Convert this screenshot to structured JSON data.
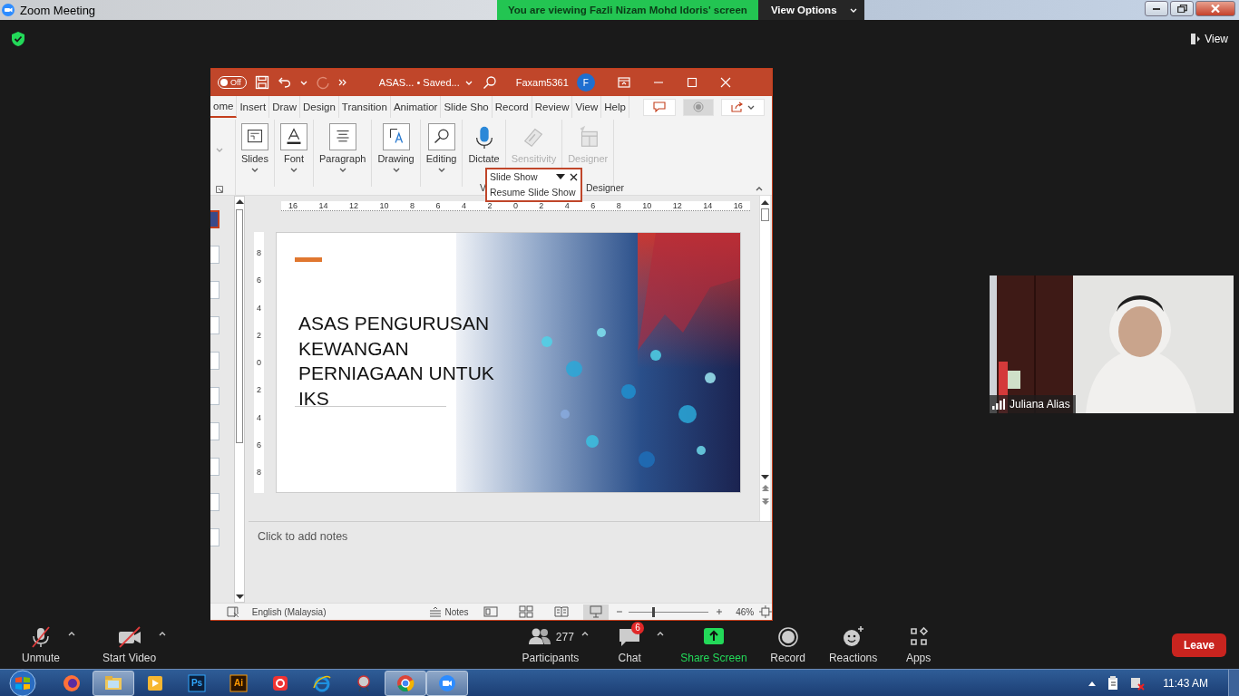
{
  "window": {
    "title": "Zoom Meeting"
  },
  "share_banner": {
    "text": "You are viewing Fazli Nizam Mohd Idoris' screen",
    "options": "View Options"
  },
  "view_button": "View",
  "shared_screen": {
    "title_bar": {
      "autosave": "Off",
      "autosave_on": false,
      "document": "ASAS...  • Saved...",
      "user": "Faxam5361",
      "avatar": "F"
    },
    "tabs": [
      {
        "label": "ome",
        "selected": true
      },
      {
        "label": "Insert",
        "selected": false
      },
      {
        "label": "Draw",
        "selected": false
      },
      {
        "label": "Design",
        "selected": false
      },
      {
        "label": "Transition",
        "selected": false
      },
      {
        "label": "Animatior",
        "selected": false
      },
      {
        "label": "Slide Sho",
        "selected": false
      },
      {
        "label": "Record",
        "selected": false
      },
      {
        "label": "Review",
        "selected": false
      },
      {
        "label": "View",
        "selected": false
      },
      {
        "label": "Help",
        "selected": false
      }
    ],
    "ribbon_groups": [
      {
        "label": "Slides",
        "kind": "slides",
        "disabled": false,
        "menu": true
      },
      {
        "label": "Font",
        "kind": "font",
        "disabled": false,
        "menu": true
      },
      {
        "label": "Paragraph",
        "kind": "paragraph",
        "disabled": false,
        "menu": true
      },
      {
        "label": "Drawing",
        "kind": "drawing",
        "disabled": false,
        "menu": true
      },
      {
        "label": "Editing",
        "kind": "editing",
        "disabled": false,
        "menu": true
      },
      {
        "label": "Dictate",
        "kind": "dictate",
        "disabled": false,
        "menu": false
      },
      {
        "label": "Sensitivity",
        "kind": "sensitivity",
        "disabled": true,
        "menu": false
      },
      {
        "label": "Designer",
        "kind": "designer",
        "disabled": true,
        "menu": false
      }
    ],
    "group_labels": [
      "V",
      "Designer"
    ],
    "popup": {
      "title": "Slide Show",
      "action": "Resume Slide Show"
    },
    "thumbnails": [
      {
        "selected": true
      },
      {
        "selected": false
      },
      {
        "selected": false
      },
      {
        "selected": false
      },
      {
        "selected": false
      },
      {
        "selected": false
      },
      {
        "selected": false
      },
      {
        "selected": false
      },
      {
        "selected": false
      },
      {
        "selected": false
      }
    ],
    "horizontal_ruler": [
      "16",
      "14",
      "12",
      "10",
      "8",
      "6",
      "4",
      "2",
      "0",
      "2",
      "4",
      "6",
      "8",
      "10",
      "12",
      "14",
      "16"
    ],
    "vertical_ruler": [
      "8",
      "6",
      "4",
      "2",
      "0",
      "2",
      "4",
      "6",
      "8"
    ],
    "slide": {
      "title_lines": [
        "ASAS PENGURUSAN",
        "KEWANGAN",
        "PERNIAGAAN UNTUK",
        "IKS"
      ]
    },
    "notes_placeholder": "Click to add notes",
    "status_bar": {
      "language": "English (Malaysia)",
      "notes": "Notes",
      "views": [
        {
          "kind": "normal",
          "selected": false
        },
        {
          "kind": "sorter",
          "selected": false
        },
        {
          "kind": "reading",
          "selected": false
        },
        {
          "kind": "slideshow",
          "selected": true
        }
      ],
      "zoom": {
        "level": 0.3,
        "reading": "46%"
      }
    }
  },
  "video": {
    "name": "Juliana Alias"
  },
  "toolbar": [
    {
      "label": "Unmute",
      "kind": "mic",
      "off": true,
      "menu": true
    },
    {
      "label": "Start Video",
      "kind": "video",
      "off": true,
      "menu": true
    },
    {
      "label": "Participants",
      "kind": "participants",
      "count": "277",
      "menu": true
    },
    {
      "label": "Chat",
      "kind": "chat",
      "badge": "6",
      "menu": true
    },
    {
      "label": "Share Screen",
      "kind": "share",
      "menu": false
    },
    {
      "label": "Record",
      "kind": "record",
      "menu": false
    },
    {
      "label": "Reactions",
      "kind": "reactions",
      "menu": false
    },
    {
      "label": "Apps",
      "kind": "apps",
      "menu": false
    }
  ],
  "leave": "Leave",
  "taskbar": {
    "apps": [
      {
        "kind": "firefox",
        "selected": false
      },
      {
        "kind": "explorer",
        "selected": true
      },
      {
        "kind": "media",
        "selected": false
      },
      {
        "kind": "ps",
        "label": "Ps",
        "selected": false
      },
      {
        "kind": "ai",
        "label": "Ai",
        "selected": false
      },
      {
        "kind": "red",
        "selected": false
      },
      {
        "kind": "ie",
        "selected": false
      },
      {
        "kind": "tool",
        "selected": false
      },
      {
        "kind": "chrome",
        "selected": true
      },
      {
        "kind": "zoom",
        "selected": true
      }
    ],
    "clock": "11:43 AM"
  }
}
